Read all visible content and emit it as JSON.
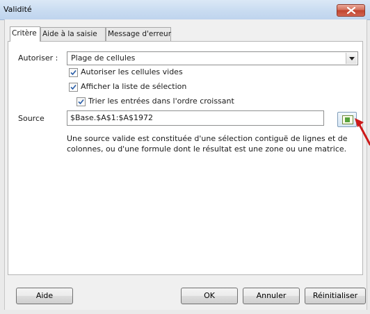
{
  "window": {
    "title": "Validité"
  },
  "tabs": [
    {
      "label": "Critère",
      "active": true
    },
    {
      "label": "Aide à la saisie",
      "active": false
    },
    {
      "label": "Message d'erreur",
      "active": false
    }
  ],
  "criteria": {
    "allow_label": "Autoriser :",
    "allow_value": "Plage de cellules",
    "options": [
      {
        "label": "Autoriser les cellules vides",
        "checked": true
      },
      {
        "label": "Afficher la liste de sélection",
        "checked": true
      },
      {
        "label": "Trier les entrées dans l'ordre croissant",
        "checked": true
      }
    ],
    "source_label": "Source",
    "source_value": "$Base.$A$1:$A$1972",
    "help_text": "Une source valide est constituée d'une sélection contiguë de lignes et de colonnes, ou d'une formule dont le résultat est une zone ou une matrice."
  },
  "buttons": {
    "help": "Aide",
    "ok": "OK",
    "cancel": "Annuler",
    "reset": "Réinitialiser"
  },
  "colors": {
    "annotation_arrow": "#cc1a1a",
    "checkmark": "#2a5ea8"
  },
  "icons": {
    "close": "close-icon",
    "dropdown": "chevron-down-icon",
    "shrink": "shrink-dialog-icon"
  }
}
